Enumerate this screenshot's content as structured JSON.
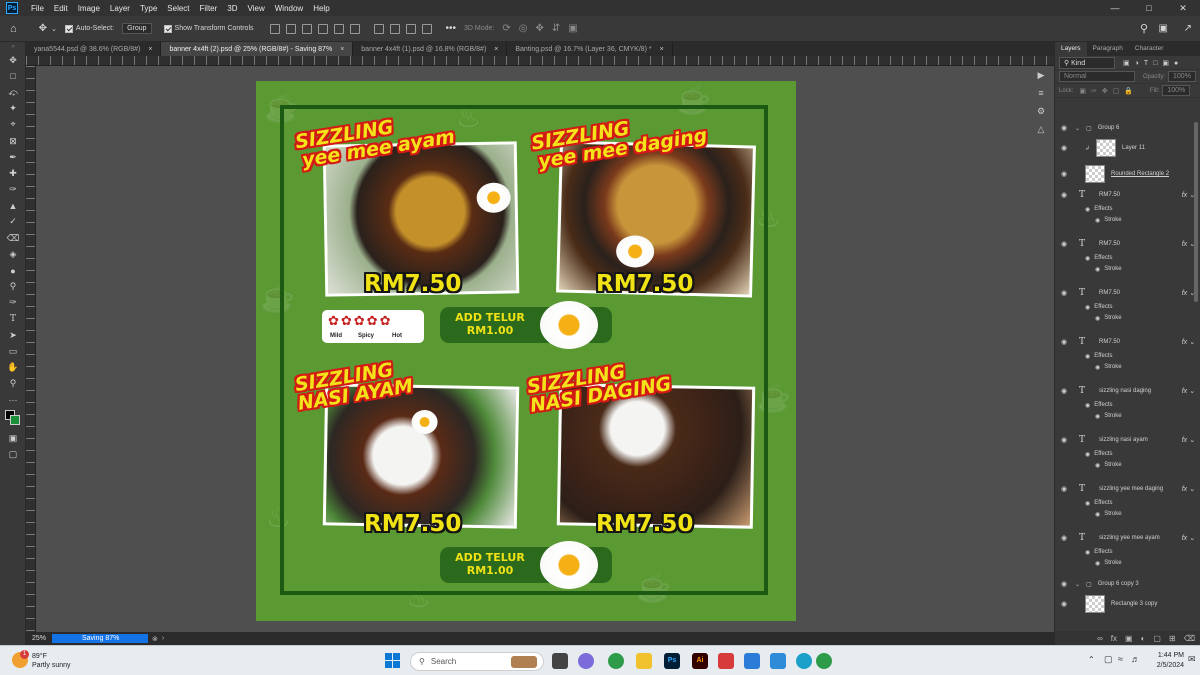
{
  "menubar": {
    "items": [
      "File",
      "Edit",
      "Image",
      "Layer",
      "Type",
      "Select",
      "Filter",
      "3D",
      "View",
      "Window",
      "Help"
    ]
  },
  "options": {
    "auto_select": "Auto-Select:",
    "group": "Group",
    "show_transform": "Show Transform Controls",
    "mode_3d": "3D Mode:"
  },
  "tabs": [
    {
      "label": "yana5544.psd @ 38.6% (RGB/8#)"
    },
    {
      "label": "banner 4x4ft (2).psd @ 25% (RGB/8#) - Saving 87%"
    },
    {
      "label": "banner 4x4ft (1).psd @ 16.8% (RGB/8#)"
    },
    {
      "label": "Banting.psd @ 16.7% (Layer 36, CMYK/8) *"
    }
  ],
  "poster": {
    "item1_title": [
      "SIZZLING",
      "yee mee ayam"
    ],
    "item2_title": [
      "SIZZLING",
      "yee mee daging"
    ],
    "item3_title": [
      "SIZZLING",
      "NASI AYAM"
    ],
    "item4_title": [
      "SIZZLING",
      "NASI DAGING"
    ],
    "price": "RM7.50",
    "add_telur_line1": "ADD TELUR",
    "add_telur_line2": "RM1.00",
    "spice_mild": "Mild",
    "spice_spicy": "Spicy",
    "spice_hot": "Hot"
  },
  "panel": {
    "tabs": [
      "Layers",
      "Paragraph",
      "Character"
    ],
    "kind": "Kind",
    "blend": "Normal",
    "opacity_label": "Opacity:",
    "opacity_value": "100%",
    "lock_label": "Lock:",
    "fill_label": "Fill:",
    "fill_value": "100%",
    "layers": [
      {
        "name": "Group 6",
        "kind": "group"
      },
      {
        "name": "Layer 11",
        "kind": "pixel"
      },
      {
        "name": "Rounded Rectangle 2",
        "kind": "shape"
      },
      {
        "name": "RM7.50",
        "kind": "text"
      },
      {
        "name": "Effects",
        "kind": "effect"
      },
      {
        "name": "Stroke",
        "kind": "sub"
      },
      {
        "name": "RM7.50",
        "kind": "text"
      },
      {
        "name": "Effects",
        "kind": "effect"
      },
      {
        "name": "Stroke",
        "kind": "sub"
      },
      {
        "name": "RM7.50",
        "kind": "text"
      },
      {
        "name": "Effects",
        "kind": "effect"
      },
      {
        "name": "Stroke",
        "kind": "sub"
      },
      {
        "name": "RM7.50",
        "kind": "text"
      },
      {
        "name": "Effects",
        "kind": "effect"
      },
      {
        "name": "Stroke",
        "kind": "sub"
      },
      {
        "name": "sizzling nasi daging",
        "kind": "text"
      },
      {
        "name": "Effects",
        "kind": "effect"
      },
      {
        "name": "Stroke",
        "kind": "sub"
      },
      {
        "name": "sizzling nasi ayam",
        "kind": "text"
      },
      {
        "name": "Effects",
        "kind": "effect"
      },
      {
        "name": "Stroke",
        "kind": "sub"
      },
      {
        "name": "sizzling yee mee daging",
        "kind": "text"
      },
      {
        "name": "Effects",
        "kind": "effect"
      },
      {
        "name": "Stroke",
        "kind": "sub"
      },
      {
        "name": "sizzling yee mee ayam",
        "kind": "text"
      },
      {
        "name": "Effects",
        "kind": "effect"
      },
      {
        "name": "Stroke",
        "kind": "sub"
      },
      {
        "name": "Group 6 copy 3",
        "kind": "group"
      },
      {
        "name": "Rectangle 3 copy",
        "kind": "shape"
      }
    ]
  },
  "status": {
    "zoom": "25%",
    "saving": "Saving 87%"
  },
  "taskbar": {
    "weather_temp": "89°F",
    "weather_desc": "Partly sunny",
    "notification_count": "1",
    "search_placeholder": "Search",
    "time": "1:44 PM",
    "date": "2/5/2024"
  },
  "colors": {
    "poster_green": "#5b9a32",
    "frame_green": "#1c5a14",
    "title_yellow": "#f4e21a",
    "title_red": "#d31a14",
    "accent_blue": "#1473e6"
  }
}
